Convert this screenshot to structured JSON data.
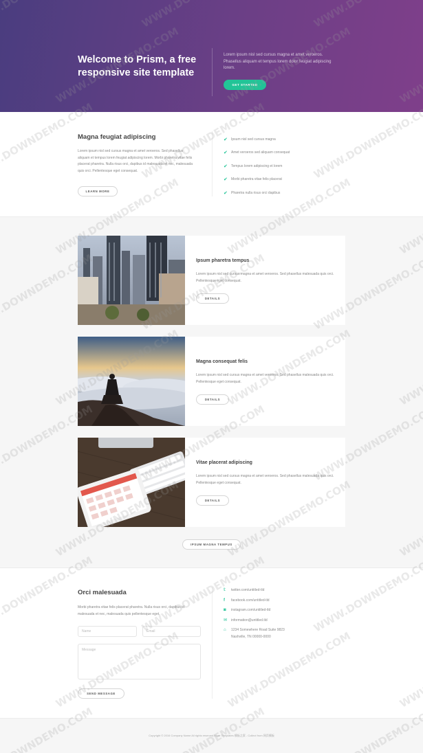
{
  "hero": {
    "title": "Welcome to Prism, a free responsive site template",
    "text": "Lorem ipsum nisl sed cursus magna et amet veroeros. Phasellus aliquam et tempus lorem dolor feugiat adipiscing lorem.",
    "button_label": "GET STARTED",
    "gradient_start": "#4a3d7f",
    "gradient_end": "#7f3f8a",
    "accent_color": "#22c497"
  },
  "intro": {
    "title": "Magna feugiat adipiscing",
    "text": "Lorem ipsum nisl sed cursus magna et amet veroeros. Sed phasellus aliquam et tempus lorem feugiat adipiscing lorem. Morbi pharetra vitae felis placerat pharetra. Nulla risus orci, dapibus id malesuada et nec, malesuada quis orci. Pellentesque eget consequat.",
    "button_label": "LEARN MORE",
    "checklist": [
      "Ipsum nisl sed cursus magna",
      "Amet veroeros sed aliquam consequat",
      "Tempus lorem adipiscing et lorem",
      "Morbi pharetra vitae felis placerat",
      "Pharetra nulla risus orci dapibus"
    ],
    "check_icon": "check-icon"
  },
  "features": {
    "cards": [
      {
        "title": "Ipsum pharetra tempus",
        "text": "Lorem ipsum nisl sed cursus magna et amet veroeros. Sed phasellus malesuada quis orci. Pellentesque eget consequat.",
        "button_label": "DETAILS",
        "image": "city-skyline-photo"
      },
      {
        "title": "Magna consequat felis",
        "text": "Lorem ipsum nisl sed cursus magna et amet veroeros. Sed phasellus malesuada quis orci. Pellentesque eget consequat.",
        "button_label": "DETAILS",
        "image": "mountain-clouds-photo"
      },
      {
        "title": "Vitae placerat adipiscing",
        "text": "Lorem ipsum nisl sed cursus magna et amet veroeros. Sed phasellus malesuada quis orci. Pellentesque eget consequat.",
        "button_label": "DETAILS",
        "image": "tablet-keyboard-photo"
      }
    ],
    "more_button_label": "IPSUM MAGNA TEMPUS"
  },
  "contact": {
    "title": "Orci malesuada",
    "text": "Morbi pharetra vitae felis placerat pharetra. Nulla risus orci, dapibus id malesuada et nec, malesuada quis pellentesque eget.",
    "name_placeholder": "Name",
    "email_placeholder": "Email",
    "message_placeholder": "Message",
    "send_label": "SEND MESSAGE",
    "twitter": "twitter.com/untitled-tld",
    "facebook": "facebook.com/untitled-tld",
    "instagram": "instagram.com/untitled-tld",
    "email": "information@untitled.tld",
    "address_line1": "1234 Somewhere Road Suite 9823",
    "address_line2": "Nashville, TN 00000-0000"
  },
  "footer": {
    "text": "Copyright © 2016 Company Name All rights reserved.More Templates 模板之家 - Collect from 网页模板"
  },
  "watermark": {
    "text": "WWW.DOWNDEMO.COM"
  }
}
